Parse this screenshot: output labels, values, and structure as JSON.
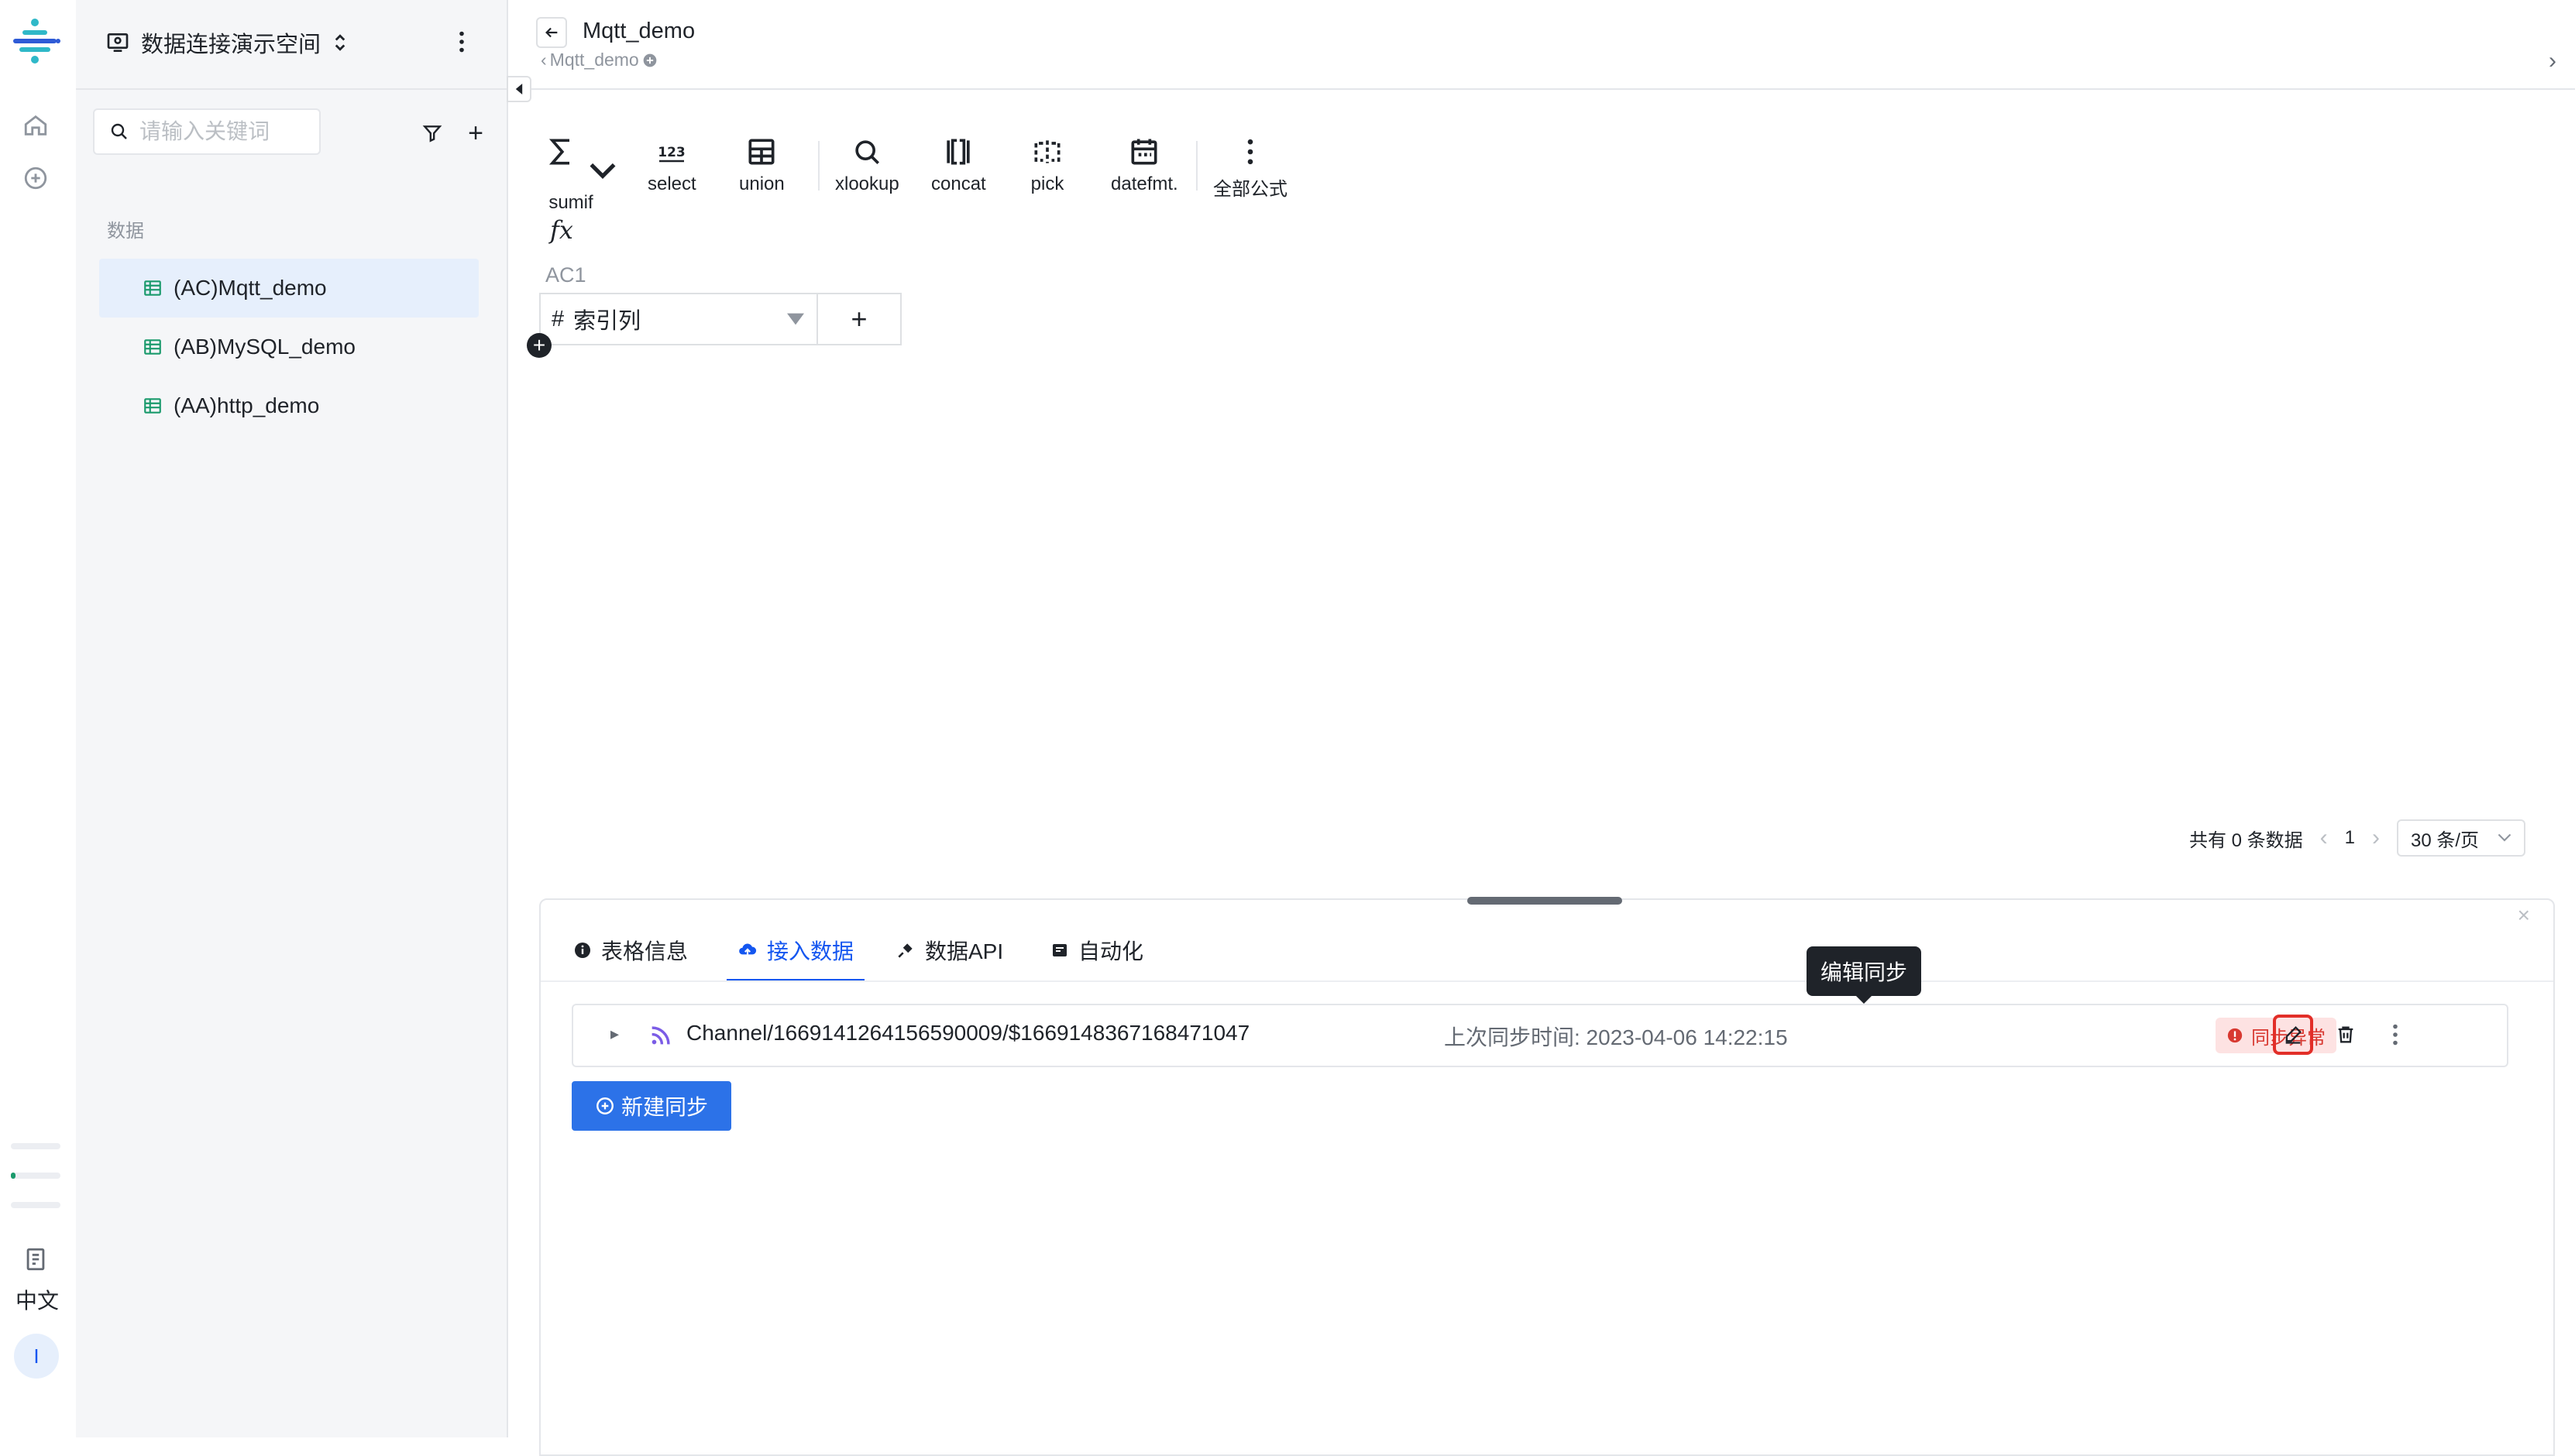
{
  "workspace": {
    "title": "数据连接演示空间"
  },
  "rail": {
    "lang_label": "中文",
    "avatar_letter": "I"
  },
  "sidebar": {
    "search_placeholder": "请输入关键词",
    "section_label": "数据",
    "tables": [
      {
        "label": "(AC)Mqtt_demo",
        "active": true
      },
      {
        "label": "(AB)MySQL_demo",
        "active": false
      },
      {
        "label": "(AA)http_demo",
        "active": false
      }
    ]
  },
  "header": {
    "title": "Mqtt_demo",
    "breadcrumb": "Mqtt_demo"
  },
  "toolbar": {
    "tools": [
      {
        "key": "sumif",
        "label": "sumif",
        "icon": "sigma-icon"
      },
      {
        "key": "select",
        "label": "select",
        "icon": "number-icon"
      },
      {
        "key": "union",
        "label": "union",
        "icon": "union-icon"
      },
      {
        "key": "xlookup",
        "label": "xlookup",
        "icon": "search-icon"
      },
      {
        "key": "concat",
        "label": "concat",
        "icon": "concat-icon"
      },
      {
        "key": "pick",
        "label": "pick",
        "icon": "pick-icon"
      },
      {
        "key": "datefmt",
        "label": "datefmt.",
        "icon": "calendar-icon"
      },
      {
        "key": "all",
        "label": "全部公式",
        "icon": "more-vertical-icon"
      }
    ]
  },
  "grid": {
    "cell_ref": "AC1",
    "column_header": "索引列"
  },
  "pagination": {
    "total_text": "共有 0 条数据",
    "current_page": "1",
    "page_size": "30 条/页"
  },
  "panel": {
    "tabs": [
      {
        "label": "表格信息",
        "active": false
      },
      {
        "label": "接入数据",
        "active": true
      },
      {
        "label": "数据API",
        "active": false
      },
      {
        "label": "自动化",
        "active": false
      }
    ],
    "sync": {
      "channel": "Channel/1669141264156590009/$1669148367168471047",
      "last_sync": "上次同步时间: 2023-04-06 14:22:15",
      "status": "同步异常"
    },
    "tooltip": "编辑同步",
    "new_sync_label": "新建同步"
  },
  "colors": {
    "accent": "#1456f0",
    "error": "#d83931",
    "button": "#2c72e8",
    "table_icon": "#1a9a6c"
  }
}
